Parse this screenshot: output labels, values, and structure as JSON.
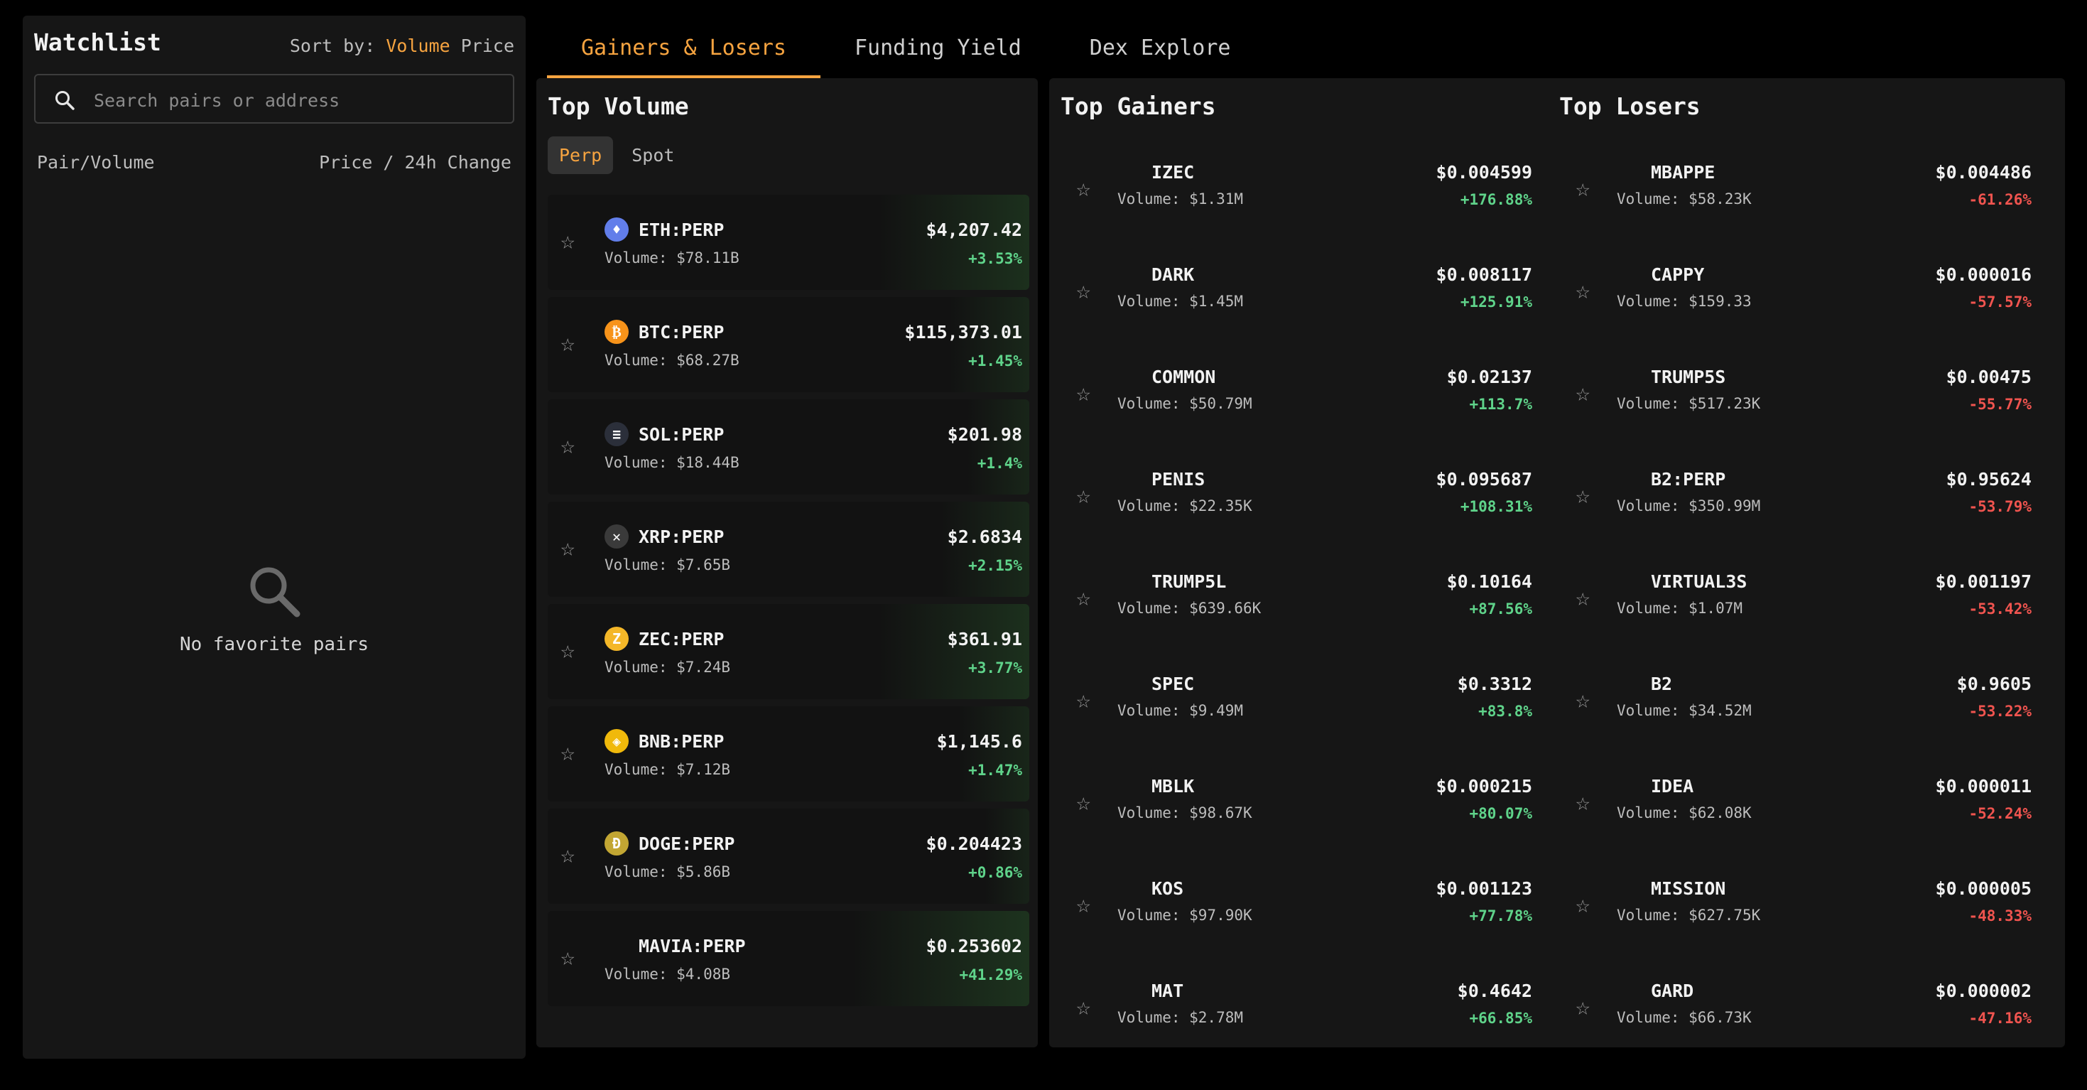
{
  "watchlist": {
    "title": "Watchlist",
    "sort_label": "Sort by:",
    "sort_volume": "Volume",
    "sort_price": "Price",
    "search_placeholder": "Search pairs or address",
    "col_pair": "Pair/Volume",
    "col_price": "Price / 24h Change",
    "empty_text": "No favorite pairs"
  },
  "tabs": [
    {
      "label": "Gainers & Losers",
      "active": true
    },
    {
      "label": "Funding Yield",
      "active": false
    },
    {
      "label": "Dex Explore",
      "active": false
    }
  ],
  "top_volume": {
    "title": "Top Volume",
    "seg_perp": "Perp",
    "seg_spot": "Spot",
    "rows": [
      {
        "symbol": "ETH:PERP",
        "volume": "Volume: $78.11B",
        "price": "$4,207.42",
        "change": "+3.53%",
        "icon": "eth-icon",
        "icon_color": "#627eea",
        "glyph": "♦",
        "highlight": 0.85
      },
      {
        "symbol": "BTC:PERP",
        "volume": "Volume: $68.27B",
        "price": "$115,373.01",
        "change": "+1.45%",
        "icon": "btc-icon",
        "icon_color": "#f7931a",
        "glyph": "₿",
        "highlight": 0.45
      },
      {
        "symbol": "SOL:PERP",
        "volume": "Volume: $18.44B",
        "price": "$201.98",
        "change": "+1.4%",
        "icon": "sol-icon",
        "icon_color": "#2b2f3a",
        "glyph": "≡",
        "highlight": 0.35
      },
      {
        "symbol": "XRP:PERP",
        "volume": "Volume: $7.65B",
        "price": "$2.6834",
        "change": "+2.15%",
        "icon": "xrp-icon",
        "icon_color": "#3a3a3a",
        "glyph": "✕",
        "highlight": 0.5
      },
      {
        "symbol": "ZEC:PERP",
        "volume": "Volume: $7.24B",
        "price": "$361.91",
        "change": "+3.77%",
        "icon": "zec-icon",
        "icon_color": "#f4b728",
        "glyph": "Z",
        "highlight": 0.85
      },
      {
        "symbol": "BNB:PERP",
        "volume": "Volume: $7.12B",
        "price": "$1,145.6",
        "change": "+1.47%",
        "icon": "bnb-icon",
        "icon_color": "#f0b90b",
        "glyph": "◈",
        "highlight": 0.4
      },
      {
        "symbol": "DOGE:PERP",
        "volume": "Volume: $5.86B",
        "price": "$0.204423",
        "change": "+0.86%",
        "icon": "doge-icon",
        "icon_color": "#c2a633",
        "glyph": "Ð",
        "highlight": 0.25
      },
      {
        "symbol": "MAVIA:PERP",
        "volume": "Volume: $4.08B",
        "price": "$0.253602",
        "change": "+41.29%",
        "icon": "",
        "icon_color": "",
        "glyph": "",
        "highlight": 1.0
      }
    ]
  },
  "gainers": {
    "title": "Top Gainers",
    "rows": [
      {
        "symbol": "IZEC",
        "volume": "Volume: $1.31M",
        "price": "$0.004599",
        "change": "+176.88%"
      },
      {
        "symbol": "DARK",
        "volume": "Volume: $1.45M",
        "price": "$0.008117",
        "change": "+125.91%"
      },
      {
        "symbol": "COMMON",
        "volume": "Volume: $50.79M",
        "price": "$0.02137",
        "change": "+113.7%"
      },
      {
        "symbol": "PENIS",
        "volume": "Volume: $22.35K",
        "price": "$0.095687",
        "change": "+108.31%"
      },
      {
        "symbol": "TRUMP5L",
        "volume": "Volume: $639.66K",
        "price": "$0.10164",
        "change": "+87.56%"
      },
      {
        "symbol": "SPEC",
        "volume": "Volume: $9.49M",
        "price": "$0.3312",
        "change": "+83.8%"
      },
      {
        "symbol": "MBLK",
        "volume": "Volume: $98.67K",
        "price": "$0.000215",
        "change": "+80.07%"
      },
      {
        "symbol": "KOS",
        "volume": "Volume: $97.90K",
        "price": "$0.001123",
        "change": "+77.78%"
      },
      {
        "symbol": "MAT",
        "volume": "Volume: $2.78M",
        "price": "$0.4642",
        "change": "+66.85%"
      }
    ]
  },
  "losers": {
    "title": "Top Losers",
    "rows": [
      {
        "symbol": "MBAPPE",
        "volume": "Volume: $58.23K",
        "price": "$0.004486",
        "change": "-61.26%"
      },
      {
        "symbol": "CAPPY",
        "volume": "Volume: $159.33",
        "price": "$0.000016",
        "change": "-57.57%"
      },
      {
        "symbol": "TRUMP5S",
        "volume": "Volume: $517.23K",
        "price": "$0.00475",
        "change": "-55.77%"
      },
      {
        "symbol": "B2:PERP",
        "volume": "Volume: $350.99M",
        "price": "$0.95624",
        "change": "-53.79%"
      },
      {
        "symbol": "VIRTUAL3S",
        "volume": "Volume: $1.07M",
        "price": "$0.001197",
        "change": "-53.42%"
      },
      {
        "symbol": "B2",
        "volume": "Volume: $34.52M",
        "price": "$0.9605",
        "change": "-53.22%"
      },
      {
        "symbol": "IDEA",
        "volume": "Volume: $62.08K",
        "price": "$0.000011",
        "change": "-52.24%"
      },
      {
        "symbol": "MISSION",
        "volume": "Volume: $627.75K",
        "price": "$0.000005",
        "change": "-48.33%"
      },
      {
        "symbol": "GARD",
        "volume": "Volume: $66.73K",
        "price": "$0.000002",
        "change": "-47.16%"
      }
    ]
  },
  "colors": {
    "accent": "#f7a440",
    "positive": "#5fd38a",
    "negative": "#f0544f",
    "panel": "#161616"
  }
}
